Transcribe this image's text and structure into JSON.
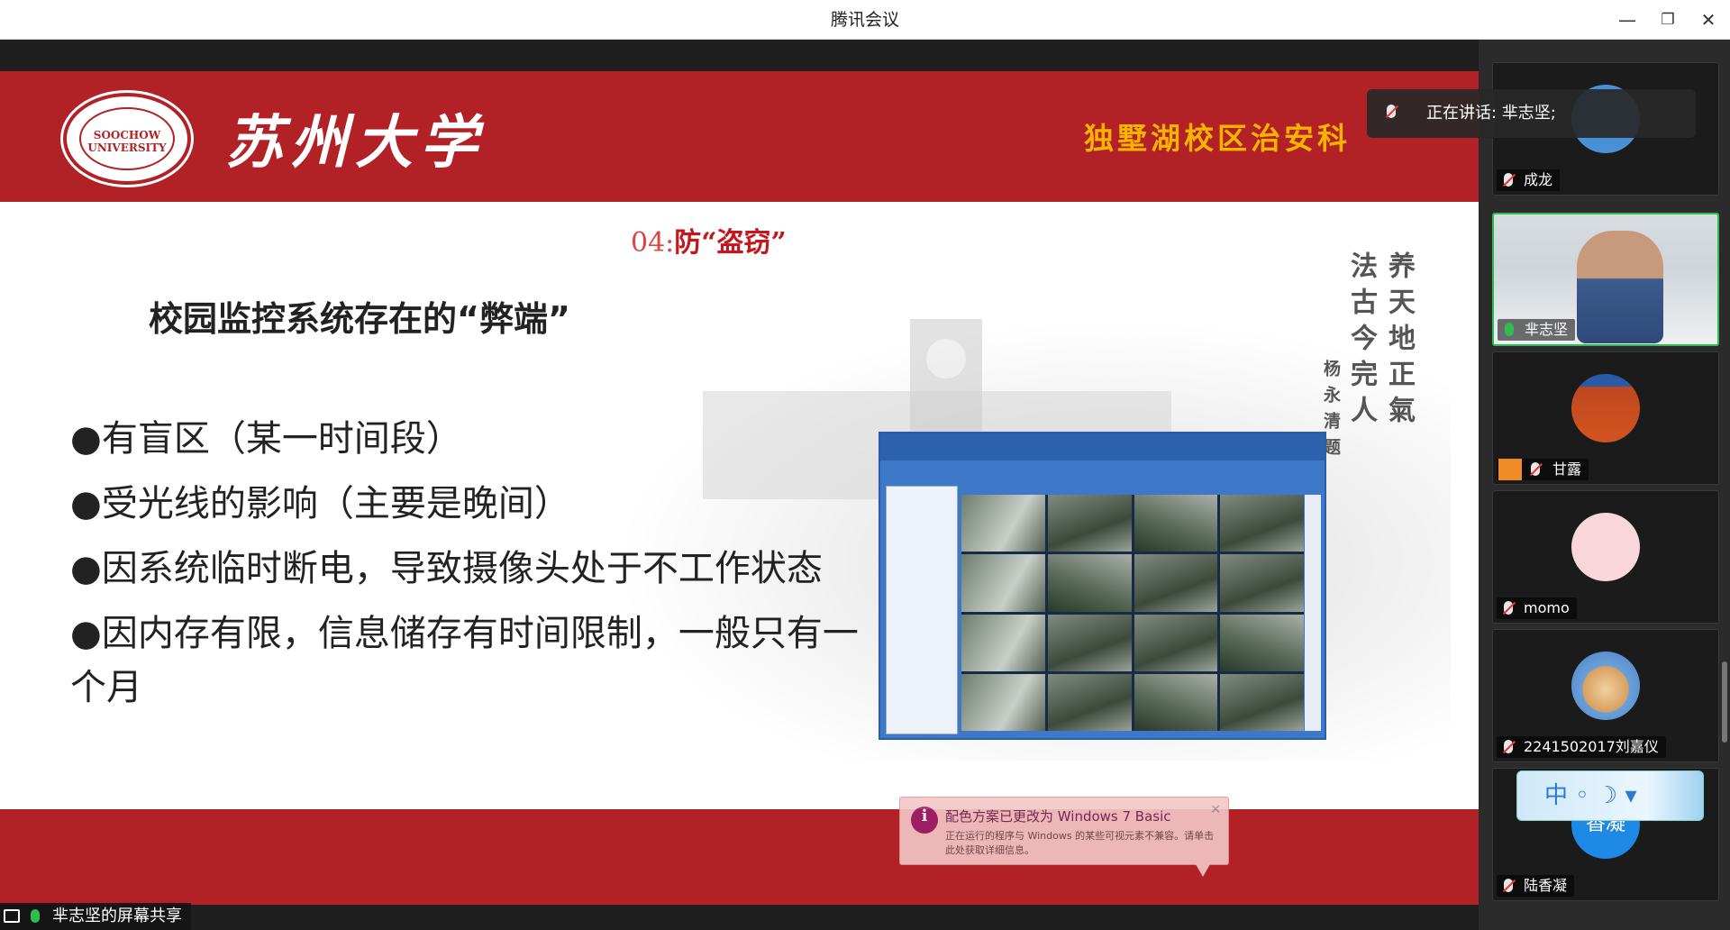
{
  "window": {
    "title": "腾讯会议",
    "minimize": "—",
    "restore": "❐",
    "close": "✕"
  },
  "slide": {
    "seal_text": "SOOCHOW UNIVERSITY",
    "brand": "苏州大学",
    "campus": "独墅湖校区治安科",
    "subtitle_num": "04:",
    "subtitle": "防“盗窃”",
    "heading": "校园监控系统存在的“弊端”",
    "bullets": [
      "●有盲区（某一时间段）",
      "●受光线的影响（主要是晚间）",
      "●因系统临时断电，导致摄像头处于不工作状态",
      "●因内存有限，信息储存有时间限制，一般只有一个月"
    ],
    "calligraphy": [
      "养天地正氣",
      "法古今完人",
      "杨永清题"
    ]
  },
  "speaking": {
    "label": "正在讲话: 芈志坚;"
  },
  "participants": [
    {
      "name": "成龙",
      "mic": "muted"
    },
    {
      "name": "芈志坚",
      "mic": "on",
      "active": true
    },
    {
      "name": "甘露",
      "mic": "muted"
    },
    {
      "name": "momo",
      "mic": "muted"
    },
    {
      "name": "2241502017刘嘉仪",
      "mic": "muted"
    },
    {
      "name": "陆香凝",
      "mic": "muted",
      "avatar_text": "香凝"
    }
  ],
  "ime": {
    "label": "中 ◦ ☽ ▾"
  },
  "notice": {
    "icon": "i",
    "title": "配色方案已更改为 Windows 7 Basic",
    "body": "正在运行的程序与 Windows 的某些可视元素不兼容。请单击此处获取详细信息。",
    "close": "×"
  },
  "share": {
    "label": "芈志坚的屏幕共享"
  }
}
